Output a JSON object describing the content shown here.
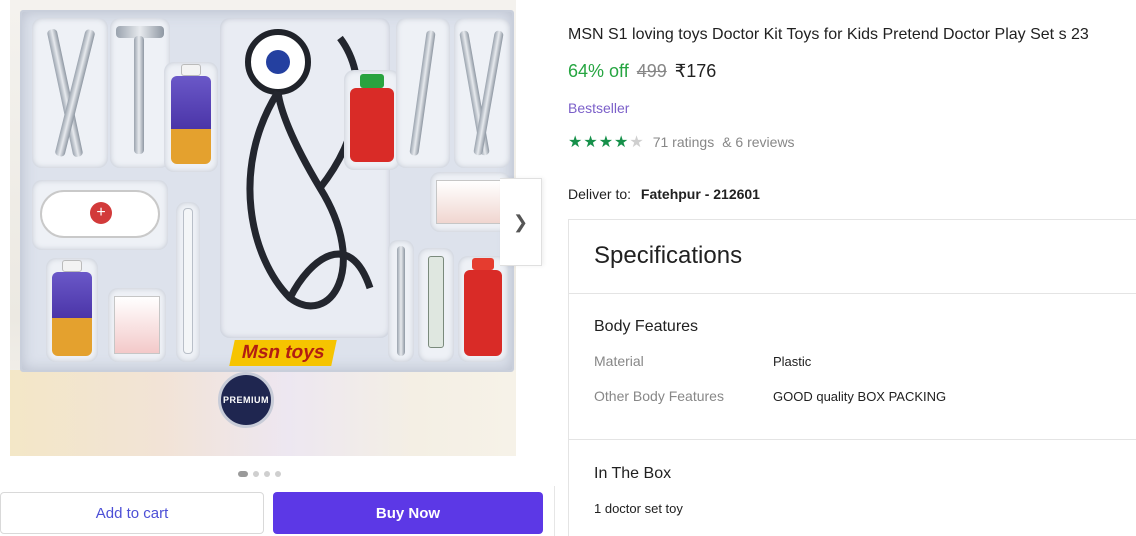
{
  "product": {
    "title": "MSN S1 loving toys Doctor Kit Toys for Kids Pretend Doctor Play Set s 23",
    "discount": "64% off",
    "mrp": "499",
    "price": "₹176",
    "badge": "Bestseller",
    "rating_value": 4.5,
    "rating_scale": 5,
    "ratings_count": "71 ratings",
    "reviews_count": "& 6 reviews"
  },
  "image": {
    "brand_label": "Msn toys",
    "seal_text": "PREMIUM",
    "carousel_dots": 4,
    "active_dot": 0,
    "next_icon": "chevron-right-icon"
  },
  "delivery": {
    "label": "Deliver to:",
    "location": "Fatehpur - 212601"
  },
  "actions": {
    "add_to_cart": "Add to cart",
    "buy_now": "Buy Now"
  },
  "specifications": {
    "heading": "Specifications",
    "body_features": {
      "title": "Body Features",
      "rows": [
        {
          "label": "Material",
          "value": "Plastic"
        },
        {
          "label": "Other Body Features",
          "value": "GOOD quality BOX PACKING"
        }
      ]
    },
    "in_the_box": {
      "title": "In The Box",
      "value": "1 doctor set toy"
    }
  },
  "colors": {
    "accent": "#5c38e6",
    "discount": "#26a541",
    "stars": "#16904a",
    "bestseller": "#7b5fc9"
  }
}
